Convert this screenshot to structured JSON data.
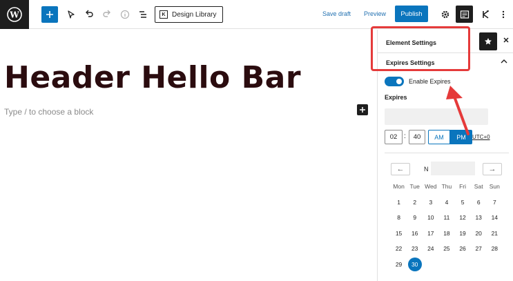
{
  "toolbar": {
    "design_library_label": "Design Library",
    "save_draft_label": "Save draft",
    "preview_label": "Preview",
    "publish_label": "Publish"
  },
  "editor": {
    "heading": "Header Hello Bar",
    "placeholder": "Type / to choose a block"
  },
  "sidebar": {
    "element_settings_label": "Element Settings",
    "expires_settings_label": "Expires Settings",
    "enable_expires_label": "Enable Expires",
    "enable_expires_on": true,
    "expires_label": "Expires",
    "hour": "02",
    "minute": "40",
    "am_label": "AM",
    "pm_label": "PM",
    "meridiem_selected": "PM",
    "utc_label": "UTC+0",
    "month_label": "N",
    "prev_arrow": "←",
    "next_arrow": "→"
  },
  "calendar": {
    "weekdays": [
      "Mon",
      "Tue",
      "Wed",
      "Thu",
      "Fri",
      "Sat",
      "Sun"
    ],
    "weeks": [
      [
        "1",
        "2",
        "3",
        "4",
        "5",
        "6",
        "7"
      ],
      [
        "8",
        "9",
        "10",
        "11",
        "12",
        "13",
        "14"
      ],
      [
        "15",
        "16",
        "17",
        "18",
        "19",
        "20",
        "21"
      ],
      [
        "22",
        "23",
        "24",
        "25",
        "26",
        "27",
        "28"
      ],
      [
        "29",
        "30",
        "",
        "",
        "",
        "",
        ""
      ]
    ],
    "selected_day": "30"
  },
  "colors": {
    "accent": "#0a75bd",
    "highlight": "#e53a3a",
    "heading": "#2b0c0f"
  }
}
